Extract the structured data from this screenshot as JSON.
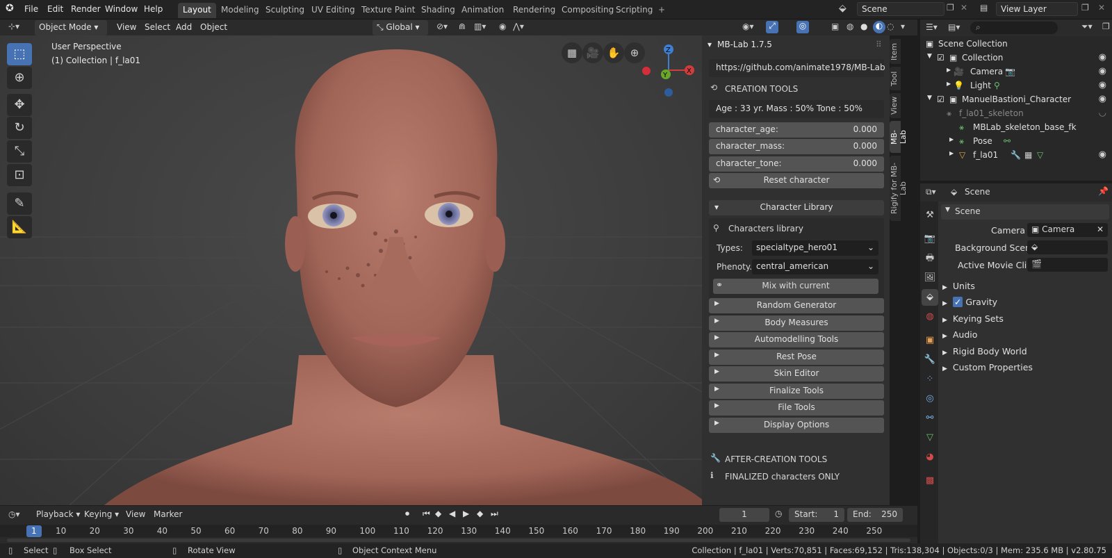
{
  "menu": {
    "items": [
      "File",
      "Edit",
      "Render",
      "Window",
      "Help"
    ]
  },
  "workspaces": [
    "Layout",
    "Modeling",
    "Sculpting",
    "UV Editing",
    "Texture Paint",
    "Shading",
    "Animation",
    "Rendering",
    "Compositing",
    "Scripting"
  ],
  "scene_field": "Scene",
  "view_layer_field": "View Layer",
  "header3d": {
    "mode": "Object Mode",
    "view": "View",
    "select": "Select",
    "add": "Add",
    "object": "Object",
    "orientation": "Global"
  },
  "viewport": {
    "perspective": "User Perspective",
    "collection": "(1) Collection | f_la01"
  },
  "gizmo": {
    "z": "Z",
    "y": "Y",
    "x": "X"
  },
  "mblab": {
    "title": "MB-Lab 1.7.5",
    "url": "https://github.com/animate1978/MB-Lab",
    "creation_tools": "CREATION TOOLS",
    "summary": "Age : 33 yr.  Mass : 50%  Tone : 50%",
    "sliders": [
      {
        "label": "character_age:",
        "value": "0.000"
      },
      {
        "label": "character_mass:",
        "value": "0.000"
      },
      {
        "label": "character_tone:",
        "value": "0.000"
      }
    ],
    "reset": "Reset character",
    "char_library_header": "Character Library",
    "char_library_label": "Characters library",
    "types_label": "Types:",
    "types_value": "specialtype_hero01",
    "pheno_label": "Phenoty..",
    "pheno_value": "central_american",
    "mix": "Mix with current",
    "sections": [
      "Random Generator",
      "Body Measures",
      "Automodelling Tools",
      "Rest Pose",
      "Skin Editor",
      "Finalize Tools",
      "File Tools",
      "Display Options"
    ],
    "after_creation": "AFTER-CREATION TOOLS",
    "finalized": "FINALIZED characters ONLY"
  },
  "side_tabs": [
    "Item",
    "Tool",
    "View",
    "MB-Lab",
    "Rigify for MB-Lab"
  ],
  "outliner": {
    "search_placeholder": "",
    "rows": [
      {
        "label": "Scene Collection"
      },
      {
        "label": "Collection"
      },
      {
        "label": "Camera"
      },
      {
        "label": "Light"
      },
      {
        "label": "ManuelBastioni_Character"
      },
      {
        "label": "f_la01_skeleton"
      },
      {
        "label": "MBLab_skeleton_base_fk"
      },
      {
        "label": "Pose"
      },
      {
        "label": "f_la01"
      }
    ]
  },
  "properties": {
    "header": "Scene",
    "panel": "Scene",
    "camera_label": "Camera",
    "camera_value": "Camera",
    "bg_scene_label": "Background Scene",
    "movie_clip_label": "Active Movie Clip",
    "subpanels": [
      "Units",
      "Gravity",
      "Keying Sets",
      "Audio",
      "Rigid Body World",
      "Custom Properties"
    ]
  },
  "timeline": {
    "playback": "Playback",
    "keying": "Keying",
    "view": "View",
    "marker": "Marker",
    "current_frame": "1",
    "start_label": "Start:",
    "start": "1",
    "end_label": "End:",
    "end": "250",
    "frames": [
      "1",
      "10",
      "20",
      "30",
      "40",
      "50",
      "60",
      "70",
      "80",
      "90",
      "100",
      "110",
      "120",
      "130",
      "140",
      "150",
      "160",
      "170",
      "180",
      "190",
      "200",
      "210",
      "220",
      "230",
      "240",
      "250"
    ]
  },
  "status": {
    "select": "Select",
    "box_select": "Box Select",
    "rotate": "Rotate View",
    "context": "Object Context Menu",
    "stats": "Collection | f_la01 | Verts:70,851 | Faces:69,152 | Tris:138,304 | Objects:0/3 | Mem: 235.6 MB | v2.80.75"
  },
  "colors": {
    "accent": "#4772b3",
    "panel": "#303030",
    "skin": "#b07264"
  }
}
